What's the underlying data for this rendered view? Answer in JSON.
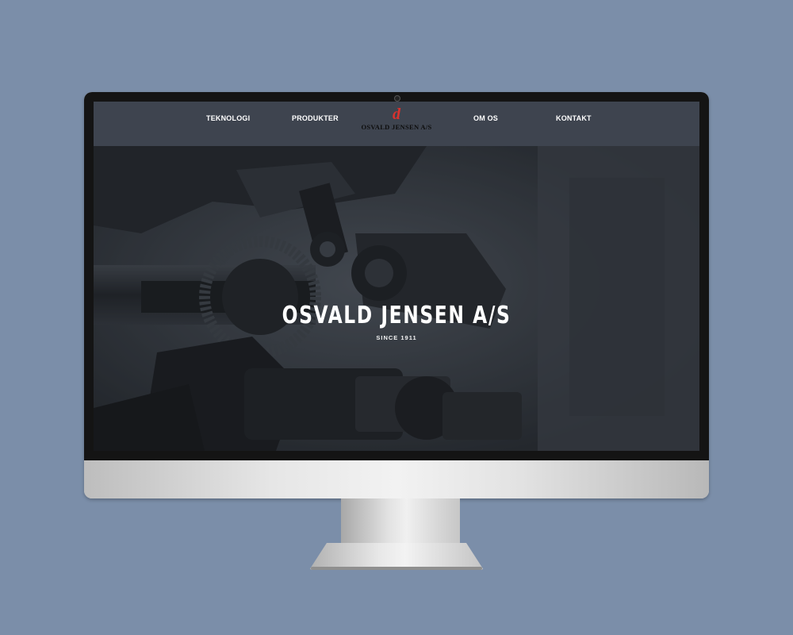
{
  "nav": {
    "items": [
      {
        "label": "TEKNOLOGI"
      },
      {
        "label": "PRODUKTER"
      },
      {
        "label": "OM OS"
      },
      {
        "label": "KONTAKT"
      }
    ]
  },
  "logo": {
    "mark": "d",
    "text": "OSVALD JENSEN A/S"
  },
  "hero": {
    "title": "OSVALD JENSEN A/S",
    "subtitle": "SINCE 1911"
  },
  "colors": {
    "background": "#7b8ea9",
    "navbar": "#3e444f",
    "logo_accent": "#d9322e",
    "hero_overlay": "#262a31"
  }
}
